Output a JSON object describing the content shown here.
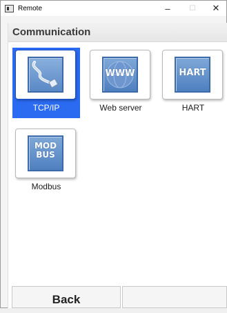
{
  "window": {
    "title": "Remote",
    "controls": {
      "minimize": "–",
      "maximize": "☐",
      "close": "✕"
    }
  },
  "section": {
    "title": "Communication"
  },
  "tiles": [
    {
      "label": "TCP/IP",
      "icon": "network-cable-icon",
      "icon_text": "",
      "selected": true
    },
    {
      "label": "Web server",
      "icon": "www-globe-icon",
      "icon_text": "WWW",
      "selected": false
    },
    {
      "label": "HART",
      "icon": "hart-icon",
      "icon_text": "HART",
      "selected": false
    },
    {
      "label": "Modbus",
      "icon": "modbus-icon",
      "icon_text": "MOD\nBUS",
      "selected": false
    }
  ],
  "footer": {
    "back_label": "Back",
    "right_label": ""
  },
  "colors": {
    "selection": "#2a6bf2",
    "icon_blue": "#5f8fcc"
  }
}
